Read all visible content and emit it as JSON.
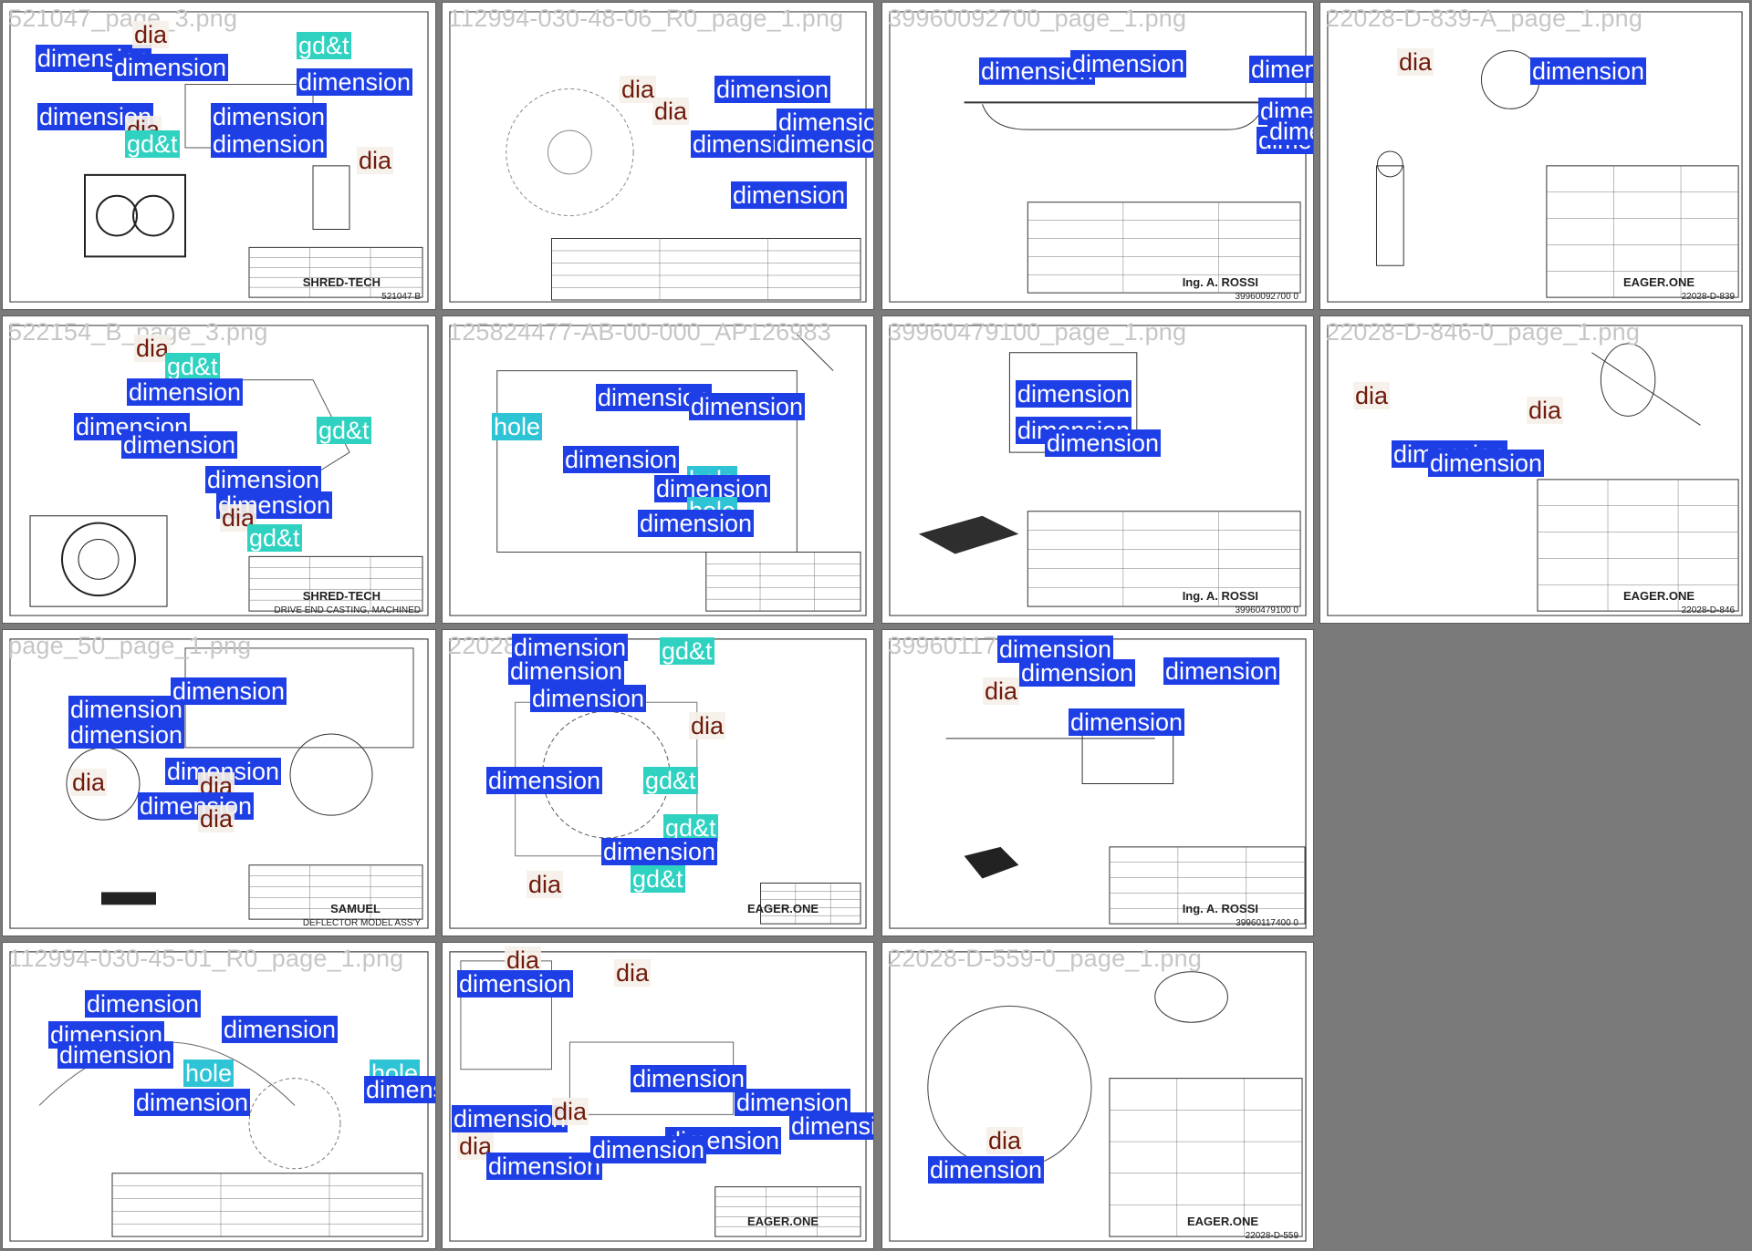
{
  "mosaic": {
    "tiles": [
      {
        "title": "521047_page_3.png",
        "labels": [
          {
            "cls": "dimension",
            "text": "dimension"
          },
          {
            "cls": "dia",
            "text": "dia"
          },
          {
            "cls": "gdt",
            "text": "gd&t"
          },
          {
            "cls": "dimension",
            "text": "dimension"
          },
          {
            "cls": "dimension",
            "text": "dimension"
          },
          {
            "cls": "dimension",
            "text": "dimension"
          },
          {
            "cls": "dia",
            "text": "dia"
          },
          {
            "cls": "gdt",
            "text": "gd&t"
          },
          {
            "cls": "dimension",
            "text": "dimension"
          },
          {
            "cls": "dimension",
            "text": "dimension"
          },
          {
            "cls": "dia",
            "text": "dia"
          }
        ],
        "title_block": {
          "company": "SHRED-TECH",
          "number": "521047 B"
        }
      },
      {
        "title": "112994-030-48-06_R0_page_1.png",
        "labels": [
          {
            "cls": "dia",
            "text": "dia"
          },
          {
            "cls": "dia",
            "text": "dia"
          },
          {
            "cls": "dimension",
            "text": "dimension"
          },
          {
            "cls": "dimension",
            "text": "dimension"
          },
          {
            "cls": "dimension",
            "text": "dimension"
          },
          {
            "cls": "dimension",
            "text": "dimension"
          },
          {
            "cls": "dimension",
            "text": "dimension"
          }
        ],
        "title_block": {
          "company": "",
          "number": ""
        }
      },
      {
        "title": "39960092700_page_1.png",
        "labels": [
          {
            "cls": "dimension",
            "text": "dimension"
          },
          {
            "cls": "dimension",
            "text": "dimension"
          },
          {
            "cls": "dimension",
            "text": "dimension"
          },
          {
            "cls": "dimension",
            "text": "dimension"
          },
          {
            "cls": "dimension",
            "text": "dimension"
          },
          {
            "cls": "dimension",
            "text": "dimension"
          }
        ],
        "title_block": {
          "company": "Ing. A. ROSSI",
          "number": "39960092700  0"
        }
      },
      {
        "title": "22028-D-839-A_page_1.png",
        "labels": [
          {
            "cls": "dia",
            "text": "dia"
          },
          {
            "cls": "dimension",
            "text": "dimension"
          }
        ],
        "title_block": {
          "company": "EAGER.ONE",
          "number": "22028-D-839"
        }
      },
      {
        "title": "522154_B_page_3.png",
        "labels": [
          {
            "cls": "dia",
            "text": "dia"
          },
          {
            "cls": "gdt",
            "text": "gd&t"
          },
          {
            "cls": "dimension",
            "text": "dimension"
          },
          {
            "cls": "dimension",
            "text": "dimension"
          },
          {
            "cls": "dimension",
            "text": "dimension"
          },
          {
            "cls": "gdt",
            "text": "gd&t"
          },
          {
            "cls": "dimension",
            "text": "dimension"
          },
          {
            "cls": "dimension",
            "text": "dimension"
          },
          {
            "cls": "dia",
            "text": "dia"
          },
          {
            "cls": "gdt",
            "text": "gd&t"
          }
        ],
        "title_block": {
          "company": "SHRED-TECH",
          "number": "DRIVE END CASTING, MACHINED"
        }
      },
      {
        "title": "125824477-AB-00-000_AP126983",
        "labels": [
          {
            "cls": "hole",
            "text": "hole"
          },
          {
            "cls": "dimension",
            "text": "dimension"
          },
          {
            "cls": "dimension",
            "text": "dimension"
          },
          {
            "cls": "dimension",
            "text": "dimension"
          },
          {
            "cls": "hole",
            "text": "hole"
          },
          {
            "cls": "dimension",
            "text": "dimension"
          },
          {
            "cls": "hole",
            "text": "hole"
          },
          {
            "cls": "dimension",
            "text": "dimension"
          }
        ],
        "title_block": {
          "company": "",
          "number": ""
        }
      },
      {
        "title": "39960479100_page_1.png",
        "labels": [
          {
            "cls": "dimension",
            "text": "dimension"
          },
          {
            "cls": "dimension",
            "text": "dimension"
          },
          {
            "cls": "dimension",
            "text": "dimension"
          }
        ],
        "title_block": {
          "company": "Ing. A. ROSSI",
          "number": "39960479100  0"
        }
      },
      {
        "title": "22028-D-846-0_page_1.png",
        "labels": [
          {
            "cls": "dia",
            "text": "dia"
          },
          {
            "cls": "dia",
            "text": "dia"
          },
          {
            "cls": "dimension",
            "text": "dimension"
          },
          {
            "cls": "dimension",
            "text": "dimension"
          }
        ],
        "title_block": {
          "company": "EAGER.ONE",
          "number": "22028-D-846"
        }
      },
      {
        "title": "page_50_page_1.png",
        "labels": [
          {
            "cls": "dimension",
            "text": "dimension"
          },
          {
            "cls": "dimension",
            "text": "dimension"
          },
          {
            "cls": "dimension",
            "text": "dimension"
          },
          {
            "cls": "dia",
            "text": "dia"
          },
          {
            "cls": "dimension",
            "text": "dimension"
          },
          {
            "cls": "dia",
            "text": "dia"
          },
          {
            "cls": "dimension",
            "text": "dimension"
          },
          {
            "cls": "dia",
            "text": "dia"
          }
        ],
        "title_block": {
          "company": "SAMUEL",
          "number": "DEFLECTOR MODEL ASS'Y"
        }
      },
      {
        "title": "22028",
        "labels": [
          {
            "cls": "dimension",
            "text": "dimension"
          },
          {
            "cls": "gdt",
            "text": "gd&t"
          },
          {
            "cls": "dimension",
            "text": "dimension"
          },
          {
            "cls": "dimension",
            "text": "dimension"
          },
          {
            "cls": "dia",
            "text": "dia"
          },
          {
            "cls": "dimension",
            "text": "dimension"
          },
          {
            "cls": "gdt",
            "text": "gd&t"
          },
          {
            "cls": "gdt",
            "text": "gd&t"
          },
          {
            "cls": "dimension",
            "text": "dimension"
          },
          {
            "cls": "dia",
            "text": "dia"
          },
          {
            "cls": "gdt",
            "text": "gd&t"
          }
        ],
        "title_block": {
          "company": "EAGER.ONE",
          "number": ""
        }
      },
      {
        "title": "39960117",
        "labels": [
          {
            "cls": "dimension",
            "text": "dimension"
          },
          {
            "cls": "dimension",
            "text": "dimension"
          },
          {
            "cls": "dimension",
            "text": "dimension"
          },
          {
            "cls": "dia",
            "text": "dia"
          },
          {
            "cls": "dimension",
            "text": "dimension"
          }
        ],
        "title_block": {
          "company": "Ing. A. ROSSI",
          "number": "39960117400  0"
        }
      },
      {
        "title": "",
        "labels": [],
        "title_block": {
          "company": "",
          "number": ""
        }
      },
      {
        "title": "112994-030-45-01_R0_page_1.png",
        "labels": [
          {
            "cls": "dimension",
            "text": "dimension"
          },
          {
            "cls": "dimension",
            "text": "dimension"
          },
          {
            "cls": "dimension",
            "text": "dimension"
          },
          {
            "cls": "dimension",
            "text": "dimension"
          },
          {
            "cls": "hole",
            "text": "hole"
          },
          {
            "cls": "dimension",
            "text": "dimension"
          },
          {
            "cls": "hole",
            "text": "hole"
          },
          {
            "cls": "dimension",
            "text": "dimension"
          }
        ],
        "title_block": {
          "company": "",
          "number": ""
        }
      },
      {
        "title": "",
        "labels": [
          {
            "cls": "dia",
            "text": "dia"
          },
          {
            "cls": "dimension",
            "text": "dimension"
          },
          {
            "cls": "dia",
            "text": "dia"
          },
          {
            "cls": "dimension",
            "text": "dimension"
          },
          {
            "cls": "dimension",
            "text": "dimension"
          },
          {
            "cls": "dimension",
            "text": "dimension"
          },
          {
            "cls": "dia",
            "text": "dia"
          },
          {
            "cls": "dimension",
            "text": "dimension"
          },
          {
            "cls": "dia",
            "text": "dia"
          },
          {
            "cls": "dimension",
            "text": "dimension"
          },
          {
            "cls": "dimension",
            "text": "dimension"
          },
          {
            "cls": "dimension",
            "text": "dimension"
          }
        ],
        "title_block": {
          "company": "EAGER.ONE",
          "number": ""
        }
      },
      {
        "title": "22028-D-559-0_page_1.png",
        "labels": [
          {
            "cls": "dia",
            "text": "dia"
          },
          {
            "cls": "dimension",
            "text": "dimension"
          }
        ],
        "title_block": {
          "company": "EAGER.ONE",
          "number": "22028-D-559"
        }
      },
      {
        "title": "",
        "labels": [],
        "title_block": {
          "company": "",
          "number": ""
        }
      }
    ]
  }
}
